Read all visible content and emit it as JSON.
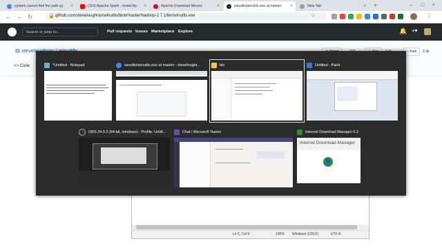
{
  "browser": {
    "tabs": [
      {
        "label": "system cannot find the path sp",
        "color": "#4285f4",
        "active": false
      },
      {
        "label": "(110) Apache Spark - Install Ap",
        "color": "#ff0000",
        "active": false
      },
      {
        "label": "Apache Download Mirrors",
        "color": "#c8102e",
        "active": false
      },
      {
        "label": "winutils/winutils.exe at master",
        "color": "#24292e",
        "active": true
      },
      {
        "label": "New Tab",
        "color": "#9aa0a6",
        "active": false
      }
    ],
    "close_glyph": "×",
    "new_tab_glyph": "+",
    "url": "github.com/steveloughran/winutils/blob/master/hadoop-2.7.1/bin/winutils.exe"
  },
  "github": {
    "search_placeholder": "Search or jump to...",
    "nav": [
      "Pull requests",
      "Issues",
      "Marketplace",
      "Explore"
    ],
    "repo_owner": "steveloughran",
    "repo_sep": " / ",
    "repo_name": "winutils",
    "watch_label": "Watch",
    "watch_count": "152",
    "star_label": "Star",
    "star_count": "1.9k",
    "fork_label": "Fork",
    "fork_count": "2.3k",
    "code_tab": "<> Code"
  },
  "notepad": {
    "position": "Ln 6, Col 9",
    "zoom": "100%",
    "line_ending": "Windows (CRLF)",
    "encoding": "UTF-8"
  },
  "switcher": {
    "windows": [
      {
        "title": "*Untitled - Notepad",
        "icon_color": "#6fa8dc"
      },
      {
        "title": "winutils/winutils.exe at master - steveloughr...",
        "icon_color": "#4285f4"
      },
      {
        "title": "bin",
        "icon_color": "#f4c542"
      },
      {
        "title": "Untitled - Paint",
        "icon_color": "#3c78d8"
      },
      {
        "title": "OBS 24.0.3 (64-bit, windows) - Profile: Untitl...",
        "icon_color": "#333333"
      },
      {
        "title": "Chat | Microsoft Teams",
        "icon_color": "#5558af"
      },
      {
        "title": "Internet Download Manager 6.3",
        "icon_color": "#2a8f3c"
      }
    ],
    "idm_splash": "Internet Download Manager"
  }
}
